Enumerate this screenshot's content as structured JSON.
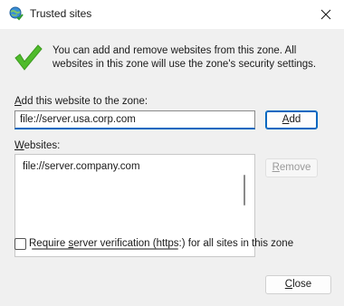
{
  "window": {
    "title": "Trusted sites",
    "icon": "globe-check-icon"
  },
  "info": {
    "text": "You can add and remove websites from this zone. All websites in this zone will use the zone's security settings.",
    "icon": "green-checkmark-icon"
  },
  "add": {
    "label_prefix": "",
    "label_access": "A",
    "label_rest": "dd this website to the zone:",
    "value": "file://server.usa.corp.com",
    "button_access": "A",
    "button_rest": "dd"
  },
  "websites": {
    "label_access": "W",
    "label_rest": "ebsites:",
    "items": [
      "file://server.company.com"
    ],
    "remove_access": "R",
    "remove_rest": "emove"
  },
  "verification": {
    "checked": false,
    "label_before": "Require ",
    "label_access": "s",
    "label_after": "erver verification (https:) for all sites in this zone"
  },
  "footer": {
    "close_access": "C",
    "close_rest": "lose"
  },
  "colors": {
    "accent": "#0067c0",
    "check_green": "#4fbb2b"
  }
}
